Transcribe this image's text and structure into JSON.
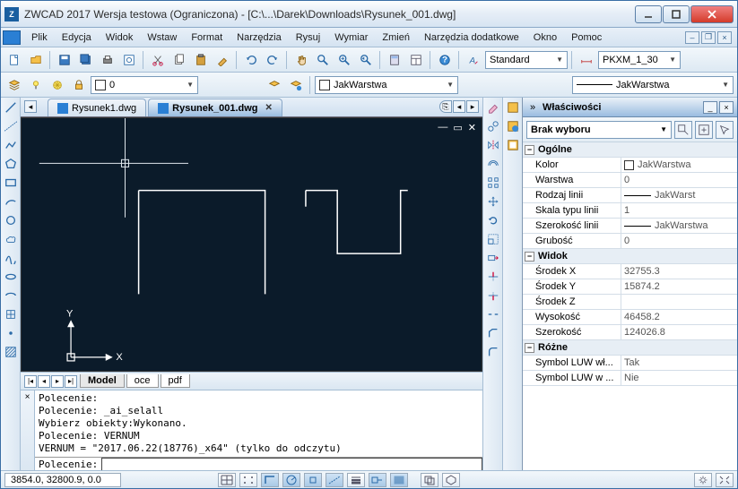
{
  "title": "ZWCAD 2017 Wersja testowa (Ograniczona) - [C:\\...\\Darek\\Downloads\\Rysunek_001.dwg]",
  "menu": [
    "Plik",
    "Edycja",
    "Widok",
    "Wstaw",
    "Format",
    "Narzędzia",
    "Rysuj",
    "Wymiar",
    "Zmień",
    "Narzędzia dodatkowe",
    "Okno",
    "Pomoc"
  ],
  "toolbar1": {
    "style_label": "Standard",
    "dimstyle_label": "PKXM_1_30"
  },
  "toolbar2": {
    "layer_combo": "0",
    "layer_prop1": "JakWarstwa",
    "layer_prop2": "JakWarstwa"
  },
  "tabs": [
    {
      "label": "Rysunek1.dwg",
      "active": false,
      "closable": false
    },
    {
      "label": "Rysunek_001.dwg",
      "active": true,
      "closable": true
    }
  ],
  "bottom_tabs": {
    "nav": [
      "|◂",
      "◂",
      "▸",
      "▸|"
    ],
    "items": [
      "Model",
      "oce",
      "pdf"
    ],
    "active": 0
  },
  "command": {
    "history": "Polecenie:\nPolecenie: _ai_selall\nWybierz obiekty:Wykonano.\nPolecenie: VERNUM\nVERNUM = \"2017.06.22(18776)_x64\" (tylko do odczytu)",
    "prompt": "Polecenie:",
    "input": ""
  },
  "properties": {
    "title": "Właściwości",
    "selection": "Brak wyboru",
    "sections": [
      {
        "name": "Ogólne",
        "rows": [
          {
            "k": "Kolor",
            "v": "JakWarstwa",
            "swatch": true
          },
          {
            "k": "Warstwa",
            "v": "0"
          },
          {
            "k": "Rodzaj linii",
            "v": "JakWarst",
            "line": true
          },
          {
            "k": "Skala typu linii",
            "v": "1"
          },
          {
            "k": "Szerokość linii",
            "v": "JakWarstwa",
            "line": true
          },
          {
            "k": "Grubość",
            "v": "0"
          }
        ]
      },
      {
        "name": "Widok",
        "rows": [
          {
            "k": "Środek X",
            "v": "32755.3"
          },
          {
            "k": "Środek Y",
            "v": "15874.2"
          },
          {
            "k": "Środek Z",
            "v": ""
          },
          {
            "k": "Wysokość",
            "v": "46458.2"
          },
          {
            "k": "Szerokość",
            "v": "124026.8"
          }
        ]
      },
      {
        "name": "Różne",
        "rows": [
          {
            "k": "Symbol LUW wł...",
            "v": "Tak"
          },
          {
            "k": "Symbol LUW w ...",
            "v": "Nie"
          }
        ]
      }
    ]
  },
  "status": {
    "coords": "3854.0, 32800.9, 0.0"
  },
  "axis": {
    "x": "X",
    "y": "Y"
  }
}
